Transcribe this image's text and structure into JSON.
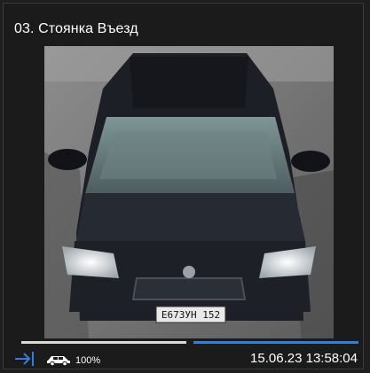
{
  "panel": {
    "title": "03. Стоянка Въезд"
  },
  "snapshot": {
    "plate": "Е673УН 152"
  },
  "progress": {
    "fraction": 0.5,
    "played_color": "#d8d8d8",
    "remaining_color": "#2f7fdc"
  },
  "toolbar": {
    "jump_icon": "arrow-to-line-icon",
    "vehicle_icon": "car-icon",
    "confidence": "100%",
    "timestamp": "15.06.23 13:58:04"
  }
}
